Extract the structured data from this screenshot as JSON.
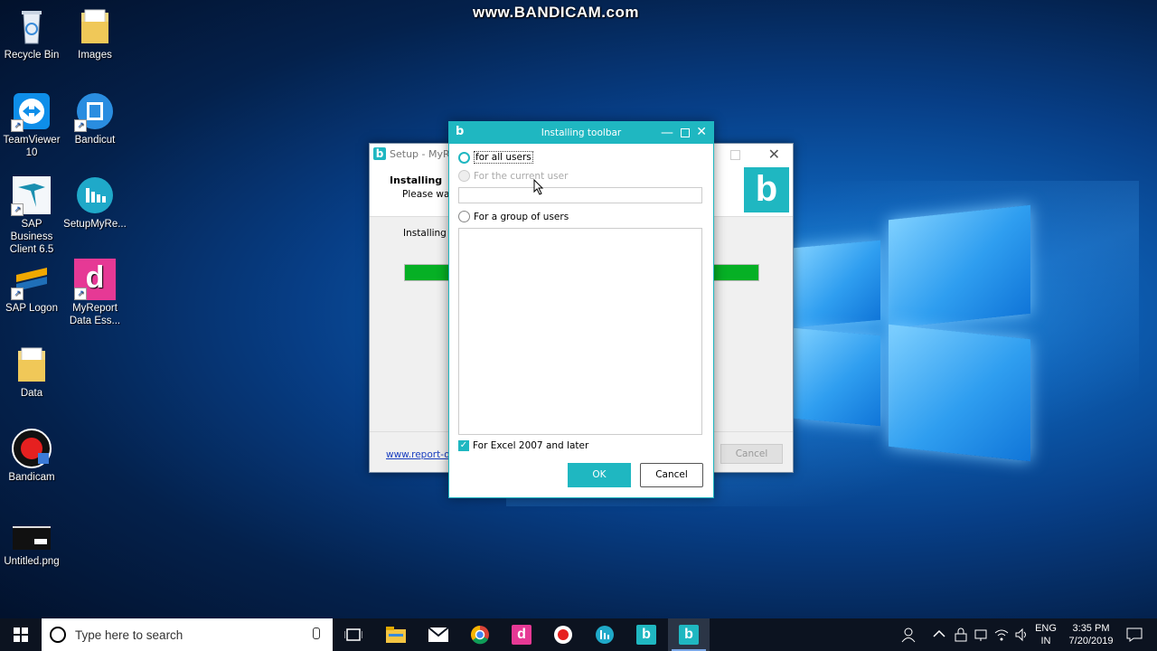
{
  "watermark": "www.BANDICAM.com",
  "desktop_icons": [
    {
      "label": "Recycle Bin",
      "icon": "recycle-bin-icon"
    },
    {
      "label": "Images",
      "icon": "folder-icon"
    },
    {
      "label": "TeamViewer 10",
      "icon": "teamviewer-icon"
    },
    {
      "label": "Bandicut",
      "icon": "bandicut-icon"
    },
    {
      "label": "SAP Business Client 6.5",
      "icon": "sap-business-client-icon"
    },
    {
      "label": "SetupMyRe...",
      "icon": "setup-myreport-icon"
    },
    {
      "label": "SAP Logon",
      "icon": "sap-logon-icon"
    },
    {
      "label": "MyReport Data Ess...",
      "icon": "myreport-icon"
    },
    {
      "label": "Data",
      "icon": "folder-icon"
    },
    {
      "label": "Bandicam",
      "icon": "bandicam-icon"
    },
    {
      "label": "Untitled.png",
      "icon": "image-file-icon"
    }
  ],
  "setup_window": {
    "title": "Setup - MyRe",
    "header_title": "Installing",
    "header_subtitle": "Please wait",
    "body_text": "Installing th",
    "progress": 1.0,
    "link": "www.report-on",
    "cancel_label": "Cancel",
    "logo_letter": "b",
    "close_glyph": "✕"
  },
  "dialog": {
    "title": "Installing toolbar",
    "logo_letter": "b",
    "minimize_glyph": "—",
    "close_glyph": "✕",
    "option_all_users": "for all users",
    "option_current_user": "For the current user",
    "option_group": "For a group of users",
    "checkbox_label": "For Excel 2007 and later",
    "checkbox_checked": true,
    "ok_label": "OK",
    "cancel_label": "Cancel",
    "accent_color": "#1fb7c1"
  },
  "taskbar": {
    "search_placeholder": "Type here to search",
    "lang": "ENG",
    "region": "IN",
    "time": "3:35 PM",
    "date": "7/20/2019"
  }
}
